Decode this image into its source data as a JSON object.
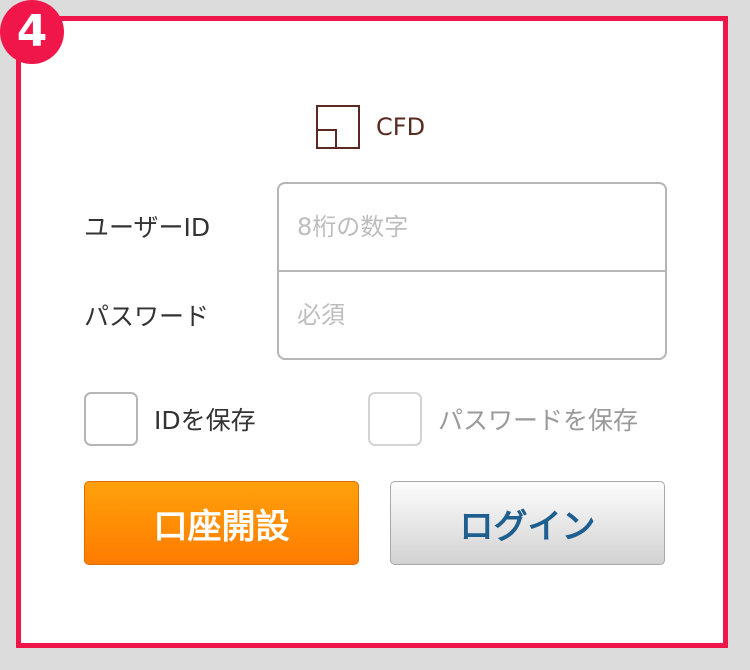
{
  "badge": {
    "number": "4"
  },
  "logo": {
    "text": "CFD",
    "icon": "window-panel-icon"
  },
  "form": {
    "user_id": {
      "label": "ユーザーID",
      "placeholder": "8桁の数字",
      "value": ""
    },
    "password": {
      "label": "パスワード",
      "placeholder": "必須",
      "value": ""
    }
  },
  "checkboxes": {
    "save_id": {
      "label": "IDを保存",
      "checked": false
    },
    "save_password": {
      "label": "パスワードを保存",
      "checked": false
    }
  },
  "buttons": {
    "open_account": "口座開設",
    "login": "ログイン"
  },
  "colors": {
    "frame_border": "#f0164a",
    "badge": "#f0164a",
    "open_button": "#ff8c00",
    "login_text": "#1e5f8f",
    "logo": "#5a2a22"
  }
}
